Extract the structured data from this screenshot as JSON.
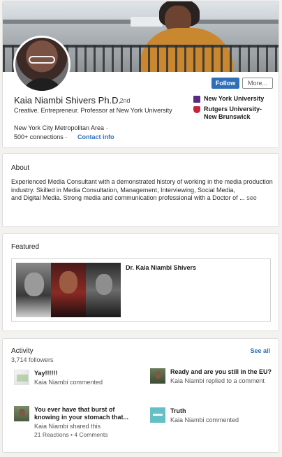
{
  "profile": {
    "name": "Kaia Niambi Shivers Ph.D.",
    "degree": "· 2nd",
    "headline": "Creative. Entrepreneur. Professor at New York University",
    "location": "New York City Metropolitan Area ·",
    "connections": "500+ connections ·",
    "contact_info": "Contact info",
    "follow_label": "Follow",
    "more_label": "More...",
    "education": [
      {
        "name": "New York University",
        "icon": "nyu-logo-icon"
      },
      {
        "name": "Rutgers University-New Brunswick",
        "icon": "rutgers-logo-icon"
      }
    ]
  },
  "about": {
    "title": "About",
    "text_before": "Experienced Media Consultant with a demonstrated history of working in the media production industry. Skilled in Media Consultation, Management, Interviewing, Social Media,",
    "text_after": "and Digital Media. Strong media and communication professional with a Doctor of ...",
    "see_more": "see"
  },
  "featured": {
    "title": "Featured",
    "item_title": "Dr. Kaia Niambi Shivers"
  },
  "activity": {
    "title": "Activity",
    "followers": "3,714 followers",
    "see_all": "See all",
    "items": [
      {
        "title": "Yay!!!!!!",
        "meta": "Kaia Niambi commented"
      },
      {
        "title": "Ready and are you still in the EU?",
        "meta": "Kaia Niambi replied to a comment"
      },
      {
        "title": "You ever have that burst of knowing in your stomach that...",
        "meta": "Kaia Niambi shared this",
        "stats": "21 Reactions • 4 Comments"
      },
      {
        "title": "Truth",
        "meta": "Kaia Niambi commented"
      }
    ]
  },
  "colors": {
    "accent": "#2e6fb7",
    "background": "#f3f2ef"
  }
}
